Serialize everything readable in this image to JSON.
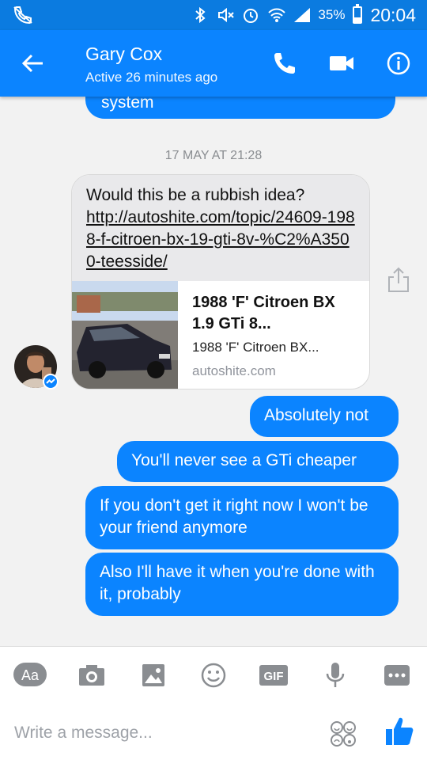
{
  "status_bar": {
    "battery_pct": "35%",
    "battery_level": 0.35,
    "time": "20:04"
  },
  "header": {
    "name": "Gary Cox",
    "status": "Active 26 minutes ago"
  },
  "conversation": {
    "previous_message_tail": "system",
    "date_separator": "17 MAY AT 21:28",
    "incoming": {
      "text": "Would this be a rubbish idea?",
      "url": "http://autoshite.com/topic/24609-1988-f-citroen-bx-19-gti-8v-%C2%A3500-teesside/",
      "preview": {
        "title": "1988 'F' Citroen BX 1.9 GTi 8...",
        "description": "1988 'F' Citroen BX...",
        "domain": "autoshite.com"
      }
    },
    "outgoing": [
      "Absolutely not",
      "You'll never see a GTi cheaper",
      "If you don't get it right now I won't be your friend anymore",
      "Also I'll have it when you're done with it, probably"
    ]
  },
  "composer": {
    "placeholder": "Write a message...",
    "aa_label": "Aa",
    "gif_label": "GIF"
  },
  "colors": {
    "accent": "#0b84ff",
    "statusbar": "#0b7be0",
    "incoming_bubble": "#e9e9eb",
    "icon_gray": "#8a8d91"
  },
  "icons": [
    "phone-icon",
    "video-camera-icon",
    "info-icon",
    "back-arrow-icon",
    "camera-icon",
    "image-icon",
    "emoji-icon",
    "microphone-icon",
    "more-icon",
    "like-icon",
    "share-icon"
  ]
}
